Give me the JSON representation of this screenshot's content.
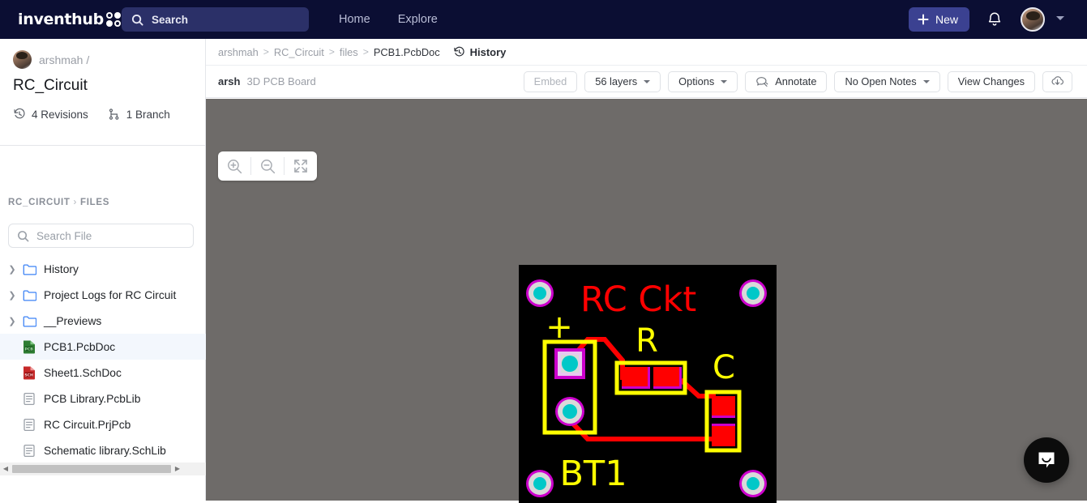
{
  "topnav": {
    "logo_text": "inventhub",
    "logo_icon": "four-dots-icon",
    "search": {
      "placeholder": "Search",
      "icon": "search-icon"
    },
    "links": [
      {
        "label": "Home",
        "name": "nav-home"
      },
      {
        "label": "Explore",
        "name": "nav-explore"
      }
    ],
    "new_button": {
      "label": "New",
      "icon": "plus-icon"
    },
    "notifications_icon": "bell-icon",
    "avatar": "user-avatar",
    "caret_icon": "chevron-down-icon"
  },
  "sidebar": {
    "owner": "arshmah /",
    "project_title": "RC_Circuit",
    "meta": [
      {
        "label": "4 Revisions",
        "icon": "history-icon"
      },
      {
        "label": "1 Branch",
        "icon": "branch-icon"
      }
    ],
    "breadcrumb": {
      "root": "RC_CIRCUIT",
      "sep": "›",
      "leaf": "FILES"
    },
    "file_search": {
      "placeholder": "Search File",
      "icon": "search-icon"
    },
    "files": [
      {
        "label": "History",
        "type": "folder",
        "expandable": true,
        "selected": false
      },
      {
        "label": "Project Logs for RC Circuit",
        "type": "folder",
        "expandable": true,
        "selected": false
      },
      {
        "label": "__Previews",
        "type": "folder",
        "expandable": true,
        "selected": false
      },
      {
        "label": "PCB1.PcbDoc",
        "type": "pcb",
        "expandable": false,
        "selected": true
      },
      {
        "label": "Sheet1.SchDoc",
        "type": "sch",
        "expandable": false,
        "selected": false
      },
      {
        "label": "PCB Library.PcbLib",
        "type": "doc",
        "expandable": false,
        "selected": false
      },
      {
        "label": "RC Circuit.PrjPcb",
        "type": "doc",
        "expandable": false,
        "selected": false
      },
      {
        "label": "Schematic library.SchLib",
        "type": "doc",
        "expandable": false,
        "selected": false
      }
    ],
    "scrollbar": {
      "left_arrow": "◀",
      "right_arrow": "▶"
    }
  },
  "main": {
    "breadcrumb": [
      "arshmah",
      "RC_Circuit",
      "files",
      "PCB1.PcbDoc"
    ],
    "breadcrumb_sep": ">",
    "history": {
      "label": "History",
      "icon": "history-icon"
    },
    "toolbar": {
      "user": "arsh",
      "subtitle": "3D PCB Board",
      "embed": "Embed",
      "layers": "56 layers",
      "options": "Options",
      "annotate": "Annotate",
      "annotate_icon": "comment-pencil-icon",
      "notes": "No Open Notes",
      "view_changes": "View Changes",
      "download_icon": "download-cloud-icon"
    },
    "zoom_controls": [
      {
        "name": "zoom-in-button",
        "icon": "zoom-in-icon"
      },
      {
        "name": "zoom-out-button",
        "icon": "zoom-out-icon"
      },
      {
        "name": "fullscreen-button",
        "icon": "expand-icon"
      }
    ],
    "intercom": {
      "icon": "chat-bubble-icon"
    }
  },
  "pcb": {
    "title_silk": "RC Ckt",
    "labels": {
      "resistor": "R",
      "capacitor": "C",
      "battery": "BT1",
      "plus": "+"
    },
    "colors": {
      "board": "#000000",
      "silkscreen_yellow": "#ffff00",
      "trace_red": "#ff0000",
      "pad_magenta": "#cc00cc",
      "pad_ring": "#d9d9d9",
      "pad_hole": "#00c8c8",
      "canvas_bg": "#6e6b69"
    }
  }
}
